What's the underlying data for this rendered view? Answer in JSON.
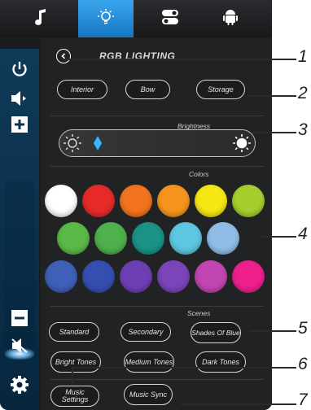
{
  "tabs": [
    {
      "icon": "music-note-icon"
    },
    {
      "icon": "light-bulb-icon"
    },
    {
      "icon": "toggle-switch-icon"
    },
    {
      "icon": "android-icon"
    }
  ],
  "sidebar": {
    "icons": [
      "power-icon",
      "speaker-volume-icon",
      "plus-icon",
      "minus-icon",
      "mute-icon",
      "settings-gear-icon"
    ]
  },
  "header": {
    "title": "RGB LIGHTING"
  },
  "zones": [
    "Interior",
    "Bow",
    "Storage"
  ],
  "brightness": {
    "label": "Brightness",
    "level": 0.05
  },
  "colors": {
    "label": "Colors",
    "rows": [
      [
        "#ffffff",
        "#e62a2a",
        "#f2731f",
        "#f7941d",
        "#f5e714",
        "#a6cf2e"
      ],
      [
        "#5ab947",
        "#4fb14b",
        "#1a9286",
        "#5ec6e0",
        "#8fbde8"
      ],
      [
        "#3f5fb8",
        "#344fb0",
        "#6e3fb4",
        "#7a45b8",
        "#c246b2",
        "#ee1f8d"
      ]
    ]
  },
  "scenes": {
    "label": "Scenes",
    "row1": [
      "Standard",
      "Secondary",
      "Shades Of Blue"
    ],
    "row2": [
      "Bright Tones",
      "Medium Tones",
      "Dark Tones"
    ]
  },
  "bottom": [
    "Music Settings",
    "Music Sync"
  ],
  "callouts": [
    "1",
    "2",
    "3",
    "4",
    "5",
    "6",
    "7"
  ]
}
